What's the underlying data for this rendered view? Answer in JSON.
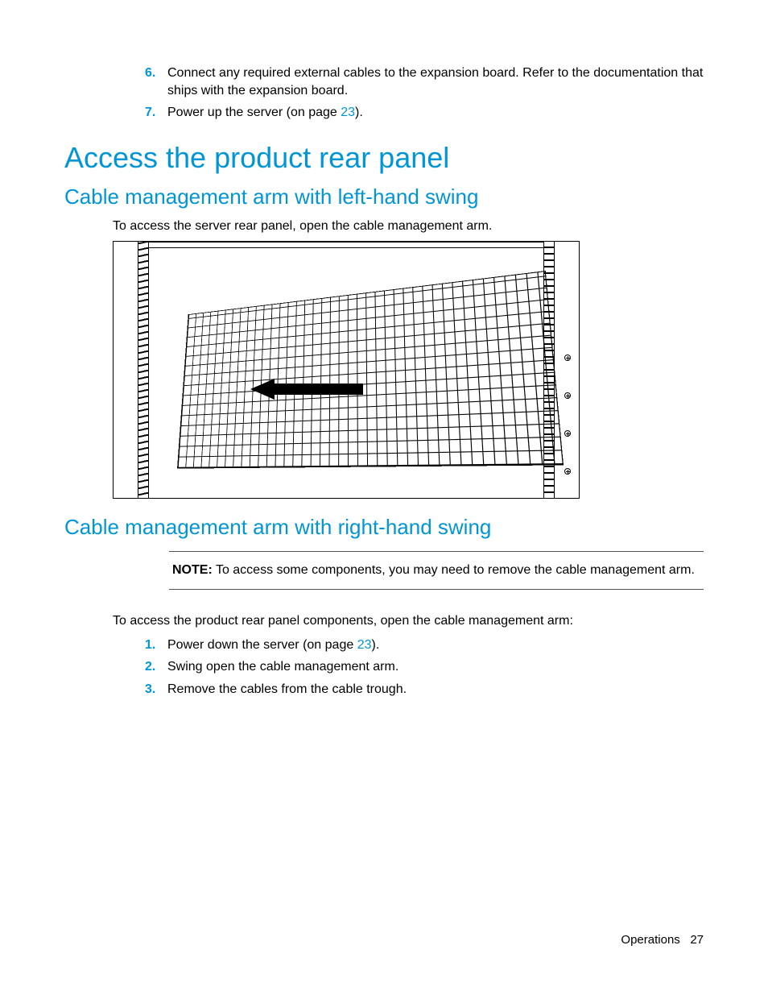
{
  "steps_top": [
    {
      "num": "6.",
      "text": "Connect any required external cables to the expansion board. Refer to the documentation that ships with the expansion board."
    },
    {
      "num": "7.",
      "text_pre": "Power up the server (on page ",
      "link": "23",
      "text_post": ")."
    }
  ],
  "heading_main": "Access the product rear panel",
  "heading_left": "Cable management arm with left-hand swing",
  "body_left": "To access the server rear panel, open the cable management arm.",
  "heading_right": "Cable management arm with right-hand swing",
  "note": {
    "label": "NOTE:",
    "text": "To access some components, you may need to remove the cable management arm."
  },
  "body_right": "To access the product rear panel components, open the cable management arm:",
  "steps_bottom": [
    {
      "num": "1.",
      "text_pre": "Power down the server (on page ",
      "link": "23",
      "text_post": ")."
    },
    {
      "num": "2.",
      "text": "Swing open the cable management arm."
    },
    {
      "num": "3.",
      "text": "Remove the cables from the cable trough."
    }
  ],
  "footer": {
    "section": "Operations",
    "page": "27"
  }
}
